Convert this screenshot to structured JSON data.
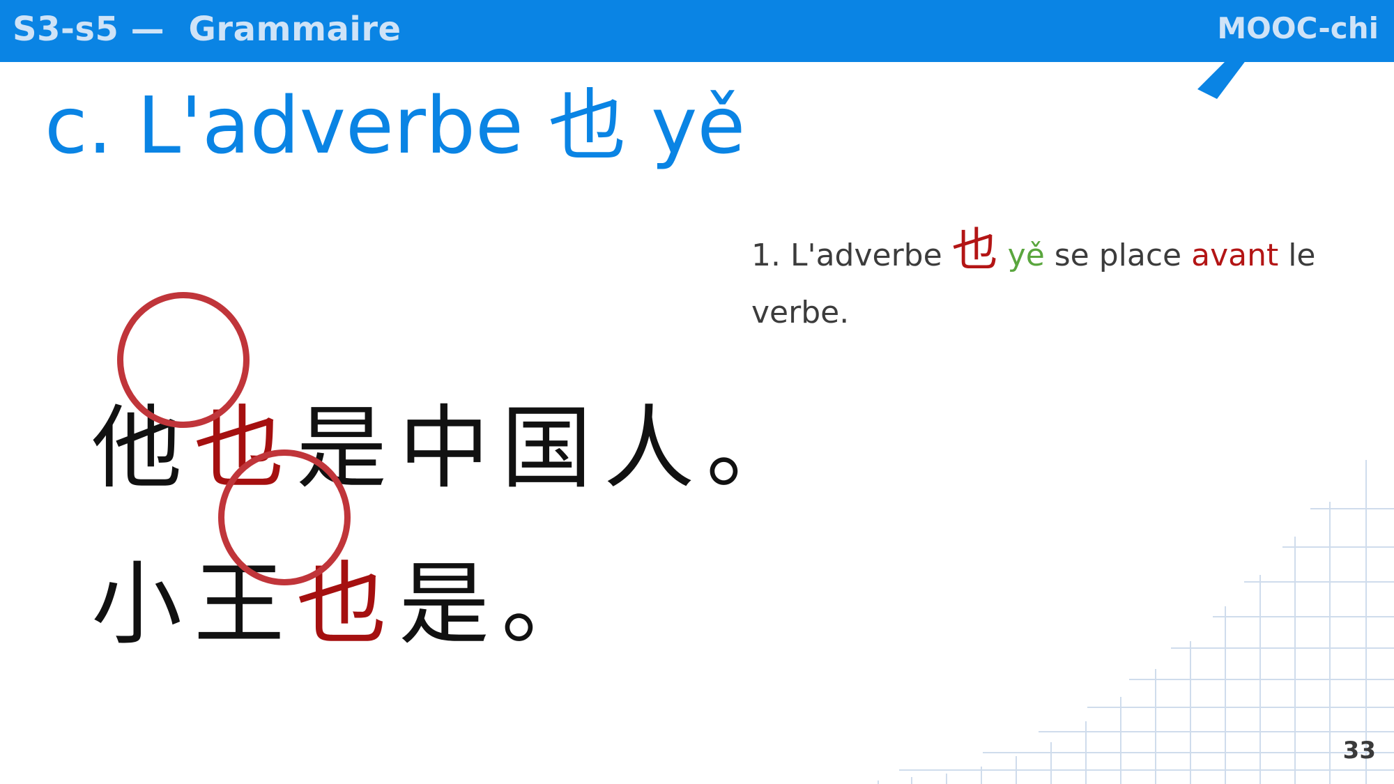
{
  "header": {
    "section": "S3-s5 —  Grammaire",
    "brand": "MOOC-chi",
    "colors": {
      "bar": "#0a84e4",
      "label": "#cfe3f7"
    }
  },
  "title": {
    "prefix": "c. L'adverbe ",
    "hanzi": "也",
    "pinyin": " yě",
    "color": "#0a84e4"
  },
  "explanation": {
    "part1": "1. L'adverbe ",
    "hanzi": "也",
    "pinyin": "yě",
    "part2": " se place ",
    "emphasis": "avant",
    "part3": " le verbe.",
    "colors": {
      "hanzi": "#b31515",
      "pinyin": "#5aa63e",
      "emphasis": "#b31515",
      "text": "#3c3c3c"
    }
  },
  "examples": [
    {
      "chars": [
        "他",
        "也",
        "是",
        "中",
        "国",
        "人",
        "。"
      ],
      "highlight_index": 1
    },
    {
      "chars": [
        "小",
        "王",
        "也",
        "是",
        "。"
      ],
      "highlight_index": 2
    }
  ],
  "highlight_color": "#c0353a",
  "page_number": "33"
}
